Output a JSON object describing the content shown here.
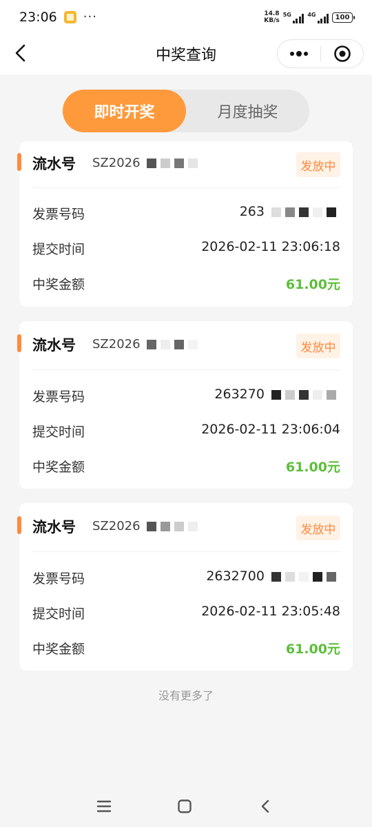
{
  "status_bar": {
    "time": "23:06",
    "more": "···",
    "speed_value": "14.8",
    "speed_unit": "KB/s",
    "net1": "5G",
    "net2": "4G",
    "battery": "100"
  },
  "nav": {
    "title": "中奖查询"
  },
  "tabs": [
    {
      "label": "即时开奖",
      "active": true
    },
    {
      "label": "月度抽奖",
      "active": false
    }
  ],
  "cards": [
    {
      "serial_label": "流水号",
      "serial": "SZ2026",
      "status": "发放中",
      "invoice_label": "发票号码",
      "invoice": "263",
      "time_label": "提交时间",
      "time": "2026-02-11 23:06:18",
      "amount_label": "中奖金额",
      "amount": "61.00元"
    },
    {
      "serial_label": "流水号",
      "serial": "SZ2026",
      "status": "发放中",
      "invoice_label": "发票号码",
      "invoice": "263270",
      "time_label": "提交时间",
      "time": "2026-02-11 23:06:04",
      "amount_label": "中奖金额",
      "amount": "61.00元"
    },
    {
      "serial_label": "流水号",
      "serial": "SZ2026",
      "status": "发放中",
      "invoice_label": "发票号码",
      "invoice": "2632700",
      "time_label": "提交时间",
      "time": "2026-02-11 23:05:48",
      "amount_label": "中奖金额",
      "amount": "61.00元"
    }
  ],
  "footer": {
    "no_more": "没有更多了"
  },
  "icons": {
    "back": "chevron-left-icon",
    "more": "more-icon",
    "close": "target-icon",
    "menu": "menu-icon",
    "home": "home-icon",
    "return": "return-icon"
  },
  "colors": {
    "accent": "#ff9a3c",
    "badge_text": "#ff8a3d",
    "badge_bg": "#fff2e6",
    "amount": "#5dbe3a"
  }
}
